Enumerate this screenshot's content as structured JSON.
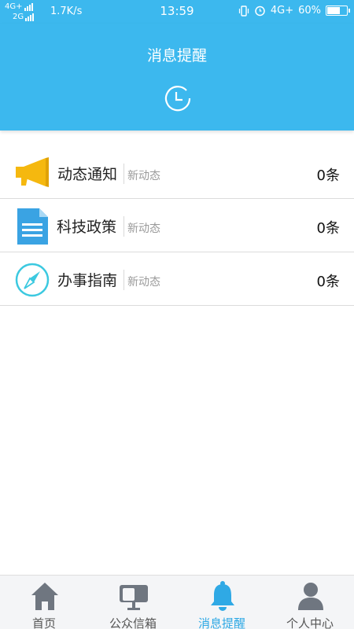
{
  "status_bar": {
    "network_top": "4G+",
    "network_bottom": "2G",
    "speed": "1.7K/s",
    "time": "13:59",
    "network_right": "4G+",
    "battery": "60%",
    "battery_level": 0.6
  },
  "header": {
    "title": "消息提醒",
    "icon": "clock-icon"
  },
  "messages": [
    {
      "icon": "megaphone-icon",
      "title": "动态通知",
      "subtitle": "新动态",
      "count": "0条"
    },
    {
      "icon": "document-icon",
      "title": "科技政策",
      "subtitle": "新动态",
      "count": "0条"
    },
    {
      "icon": "compass-icon",
      "title": "办事指南",
      "subtitle": "新动态",
      "count": "0条"
    }
  ],
  "tabs": [
    {
      "label": "首页",
      "icon": "home-icon",
      "active": false
    },
    {
      "label": "公众信箱",
      "icon": "mailbox-icon",
      "active": false
    },
    {
      "label": "消息提醒",
      "icon": "bell-icon",
      "active": true
    },
    {
      "label": "个人中心",
      "icon": "person-icon",
      "active": false
    }
  ],
  "colors": {
    "primary": "#3cb8ee",
    "active_tab": "#2fa9e5",
    "megaphone": "#f5b80f",
    "document": "#3aa3e3",
    "compass": "#3cc9e0"
  }
}
